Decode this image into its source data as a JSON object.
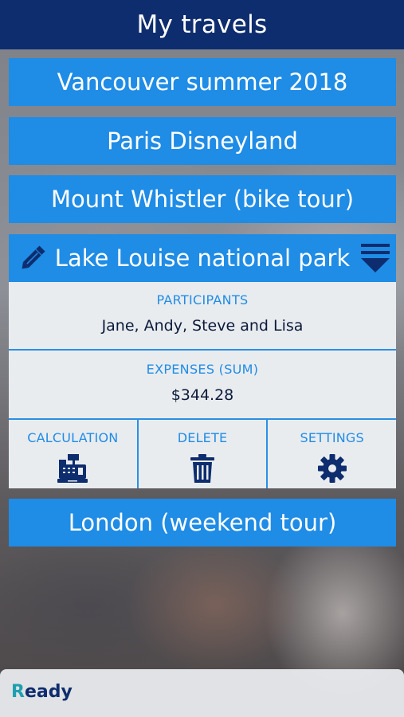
{
  "header": {
    "title": "My travels"
  },
  "trips": [
    {
      "name": "Vancouver summer 2018"
    },
    {
      "name": "Paris Disneyland"
    },
    {
      "name": "Mount Whistler (bike tour)"
    }
  ],
  "expanded_trip": {
    "name": "Lake Louise national park",
    "participants_label": "PARTICIPANTS",
    "participants": "Jane, Andy, Steve and Lisa",
    "expenses_label": "EXPENSES (SUM)",
    "expenses": "$344.28",
    "actions": [
      {
        "label": "CALCULATION",
        "icon": "cash-register-icon"
      },
      {
        "label": "DELETE",
        "icon": "trash-icon"
      },
      {
        "label": "SETTINGS",
        "icon": "gear-icon"
      }
    ]
  },
  "trips_after": [
    {
      "name": "London (weekend tour)"
    }
  ],
  "status": {
    "first_letter": "R",
    "rest": "eady"
  },
  "colors": {
    "header_bg": "#0e2d6e",
    "button_bg": "#1f8ce6",
    "card_bg": "#e9ecef",
    "accent_text": "#1f8ce6",
    "dark_text": "#0c1b3a",
    "status_accent": "#1e9fb0"
  }
}
